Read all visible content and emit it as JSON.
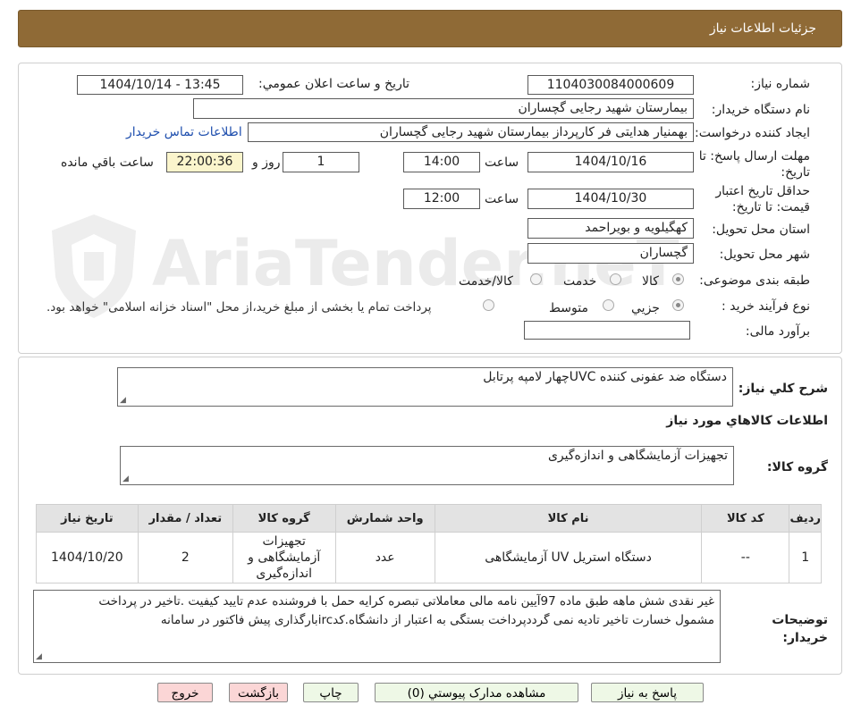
{
  "header": {
    "title": "جزئیات اطلاعات نیاز"
  },
  "watermark": {
    "text": "AriaTender.neT"
  },
  "fields": {
    "need_number_label": "شماره نیاز:",
    "need_number": "1104030084000609",
    "announce_label": "تاریخ و ساعت اعلان عمومي:",
    "announce_value": "1404/10/14 - 13:45",
    "buyer_org_label": "نام دستگاه خریدار:",
    "buyer_org": "بیمارستان شهید رجایی گچساران",
    "requester_label": "ایجاد کننده درخواست:",
    "requester": "بهمنیار هدایتی فر کارپرداز بیمارستان شهید رجایی گچساران",
    "contact_link": "اطلاعات تماس خریدار",
    "deadline_label": "مهلت ارسال پاسخ: تا تاریخ:",
    "deadline_date": "1404/10/16",
    "time_word": "ساعت",
    "deadline_time": "14:00",
    "days_value": "1",
    "days_label": "روز و",
    "remaining_time": "22:00:36",
    "remaining_label": "ساعت باقي مانده",
    "validity_label": "حداقل تاریخ اعتبار قیمت: تا تاریخ:",
    "validity_date": "1404/10/30",
    "validity_time": "12:00",
    "province_label": "استان محل تحویل:",
    "province": "کهگیلویه و بویراحمد",
    "city_label": "شهر محل تحویل:",
    "city": "گچساران",
    "category_label": "طبقه بندی موضوعی:",
    "category_options": [
      "کالا",
      "خدمت",
      "کالا/خدمت"
    ],
    "category_selected": "کالا",
    "process_label": "نوع فرآیند خرید :",
    "process_options": [
      "جزیي",
      "متوسط"
    ],
    "process_selected": "جزیي",
    "process_note": "پرداخت تمام یا بخشی از مبلغ خرید،از محل \"اسناد خزانه اسلامی\" خواهد بود.",
    "budget_label": "برآورد مالی:",
    "budget_value": ""
  },
  "summary": {
    "label": "شرح کلي نیاز:",
    "text": "دستگاه ضد عفونی کننده UVCچهار لامپه پرتابل"
  },
  "goods": {
    "section_title": "اطلاعات کالاهاي مورد نیاز",
    "group_label": "گروه کالا:",
    "group_value": "تجهیزات آزمایشگاهی و اندازه‌گیری",
    "columns": [
      "ردیف",
      "کد کالا",
      "نام کالا",
      "واحد شمارش",
      "گروه کالا",
      "تعداد / مقدار",
      "تاریخ نیاز"
    ],
    "rows": [
      {
        "row": "1",
        "code": "--",
        "name": "دستگاه استریل UV آزمایشگاهی",
        "unit": "عدد",
        "group": "تجهیزات آزمایشگاهی و اندازه‌گیری",
        "qty": "2",
        "date": "1404/10/20"
      }
    ]
  },
  "buyer_notes": {
    "label": "توضیحات خریدار:",
    "line1": "غیر نقدی شش ماهه طبق ماده 97آیین نامه مالی معاملاتی تبصره کرایه حمل با فروشنده عدم تایید کیفیت .تاخیر در پرداخت",
    "line2": "مشمول خسارت تاخیر تادیه نمی گرددپرداخت بستگی به اعتبار از دانشگاه.کدircبارگذاری پیش فاکتور در سامانه"
  },
  "buttons": {
    "reply": "پاسخ به نیاز",
    "attachments": "مشاهده مدارک پیوستي (0)",
    "print": "چاپ",
    "back": "بازگشت",
    "exit": "خروج"
  },
  "colors": {
    "header_bg": "#8f6a36",
    "button_green": "#eef8e6",
    "button_pink": "#fbd6d6",
    "highlight": "#fbf5cc"
  }
}
